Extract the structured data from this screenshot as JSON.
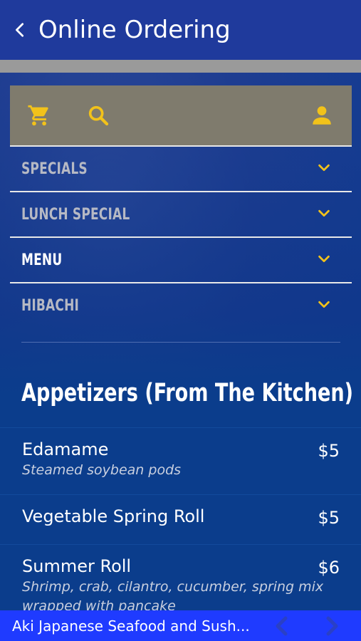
{
  "header": {
    "title": "Online Ordering",
    "back_icon": "chevron-left-icon"
  },
  "toolbar": {
    "icons": [
      "cart-icon",
      "search-icon",
      "user-icon"
    ],
    "icon_color": "#f2c21a"
  },
  "menu": {
    "items": [
      {
        "label": "SPECIALS",
        "active": false
      },
      {
        "label": "LUNCH SPECIAL",
        "active": false
      },
      {
        "label": "MENU",
        "active": true
      },
      {
        "label": "HIBACHI",
        "active": false
      }
    ],
    "chevron_icon": "chevron-down-icon"
  },
  "section": {
    "title": "Appetizers (From The Kitchen)"
  },
  "dishes": [
    {
      "name": "Edamame",
      "price": "$5",
      "desc": "Steamed soybean pods"
    },
    {
      "name": "Vegetable Spring Roll",
      "price": "$5",
      "desc": ""
    },
    {
      "name": "Summer Roll",
      "price": "$6",
      "desc": "Shrimp, crab, cilantro, cucumber, spring mix wrapped with pancake"
    }
  ],
  "footer": {
    "name": "Aki Japanese Seafood and Sush...",
    "prev_icon": "prev-arrow-icon",
    "next_icon": "next-arrow-icon"
  },
  "colors": {
    "header": "#1f3a9c",
    "accent": "#f2c21a",
    "footer": "#1f3bff",
    "background": "#0b3d8c"
  }
}
